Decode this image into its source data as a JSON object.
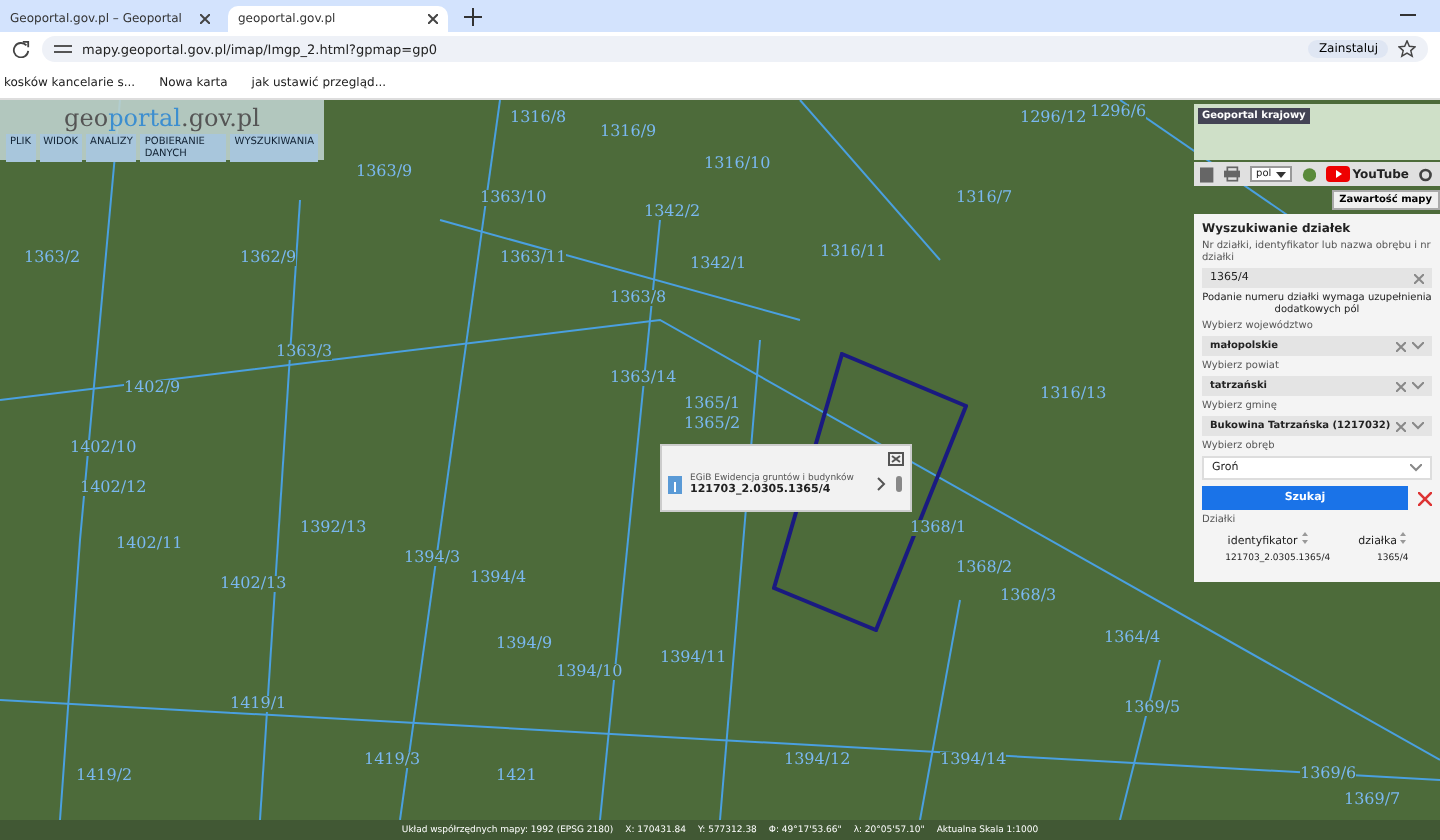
{
  "browser": {
    "tabs": [
      {
        "label": "Geoportal.gov.pl – Geoportal",
        "selected": false
      },
      {
        "label": "geoportal.gov.pl",
        "selected": true
      }
    ],
    "address": "mapy.geoportal.gov.pl/imap/Imgp_2.html?gpmap=gp0",
    "install_button": "Zainstaluj",
    "bookmarks": [
      "kosków kancelarie s...",
      "Nowa karta",
      "jak ustawić przegląd..."
    ]
  },
  "app": {
    "logo_prefix": "geo",
    "logo_accent": "portal",
    "logo_suffix": ".gov.pl",
    "menu": [
      "PLIK",
      "WIDOK",
      "ANALIZY",
      "POBIERANIE DANYCH",
      "WYSZUKIWANIA"
    ]
  },
  "map": {
    "parcel_labels": [
      "1316/8",
      "1316/9",
      "1296/12",
      "1296/6",
      "1363/9",
      "1363/10",
      "1316/10",
      "1342/2",
      "1316/7",
      "1363/2",
      "1362/9",
      "1363/11",
      "1342/1",
      "1316/11",
      "1363/8",
      "1363/3",
      "1402/9",
      "1363/14",
      "1365/1",
      "1365/2",
      "1316/13",
      "1402/10",
      "1402/12",
      "1392/13",
      "1402/11",
      "1368/1",
      "1394/3",
      "1394/4",
      "1368/2",
      "1402/13",
      "1368/3",
      "1364/4",
      "1394/9",
      "1394/10",
      "1394/11",
      "1419/1",
      "1369/5",
      "1419/3",
      "1394/12",
      "1394/14",
      "1419/2",
      "1421",
      "1369/6",
      "1369/7"
    ],
    "popup": {
      "layer": "EGiB Ewidencja gruntów i budynków",
      "identifier": "121703_2.0305.1365/4"
    }
  },
  "overview": {
    "title": "Geoportal krajowy"
  },
  "toolbar": {
    "language": "pol",
    "youtube": "YouTube",
    "contents_button": "Zawartość mapy"
  },
  "search_panel": {
    "title": "Wyszukiwanie działek",
    "hint": "Nr działki, identyfikator lub nazwa obrębu i nr działki",
    "query": "1365/4",
    "note": "Podanie numeru działki wymaga uzupełnienia dodatkowych pól",
    "fields": [
      {
        "label": "Wybierz województwo",
        "value": "małopolskie"
      },
      {
        "label": "Wybierz powiat",
        "value": "tatrzański"
      },
      {
        "label": "Wybierz gminę",
        "value": "Bukowina Tatrzańska (1217032)"
      }
    ],
    "precinct_label": "Wybierz obręb",
    "precinct": "Groń",
    "search_button": "Szukaj",
    "results_title": "Działki",
    "columns": [
      "identyfikator",
      "działka"
    ],
    "rows": [
      [
        "121703_2.0305.1365/4",
        "1365/4"
      ]
    ]
  },
  "status_bar": [
    "Układ współrzędnych mapy: 1992 (EPSG 2180)",
    "X: 170431.84",
    "Y: 577312.38",
    "Φ: 49°17'53.66\"",
    "λ: 20°05'57.10\"",
    "Aktualna Skala 1:1000"
  ]
}
